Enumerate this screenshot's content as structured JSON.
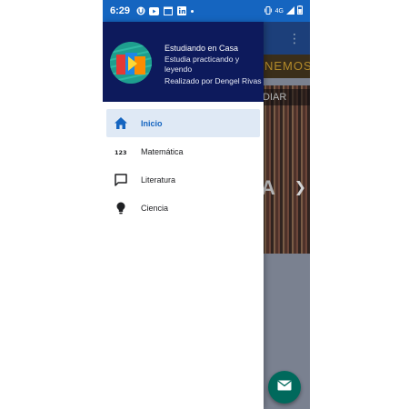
{
  "status_bar": {
    "time": "6:29",
    "network": "4G",
    "icons": [
      "u-app-icon",
      "youtube-icon",
      "calendar-icon",
      "linkedin-icon",
      "dot-icon"
    ]
  },
  "drawer": {
    "header": {
      "title": "Estudiando en Casa",
      "subtitle": "Estudia practicando y leyendo",
      "author": "Realizado por Dengel Rivas"
    },
    "items": [
      {
        "label": "Inicio",
        "icon": "home-icon",
        "active": true
      },
      {
        "label": "Matemática",
        "icon": "numbers-123-icon",
        "active": false
      },
      {
        "label": "Literatura",
        "icon": "chat-bubble-icon",
        "active": false
      },
      {
        "label": "Ciencia",
        "icon": "lightbulb-icon",
        "active": false
      }
    ]
  },
  "background": {
    "banner_text": "NEMOS",
    "image_caption": "DIAR",
    "image_text": "A"
  },
  "colors": {
    "primary": "#1565c0",
    "drawer_header": "#0d1a5c",
    "active_item_bg": "#dfe9f5",
    "fab": "#00695c"
  }
}
